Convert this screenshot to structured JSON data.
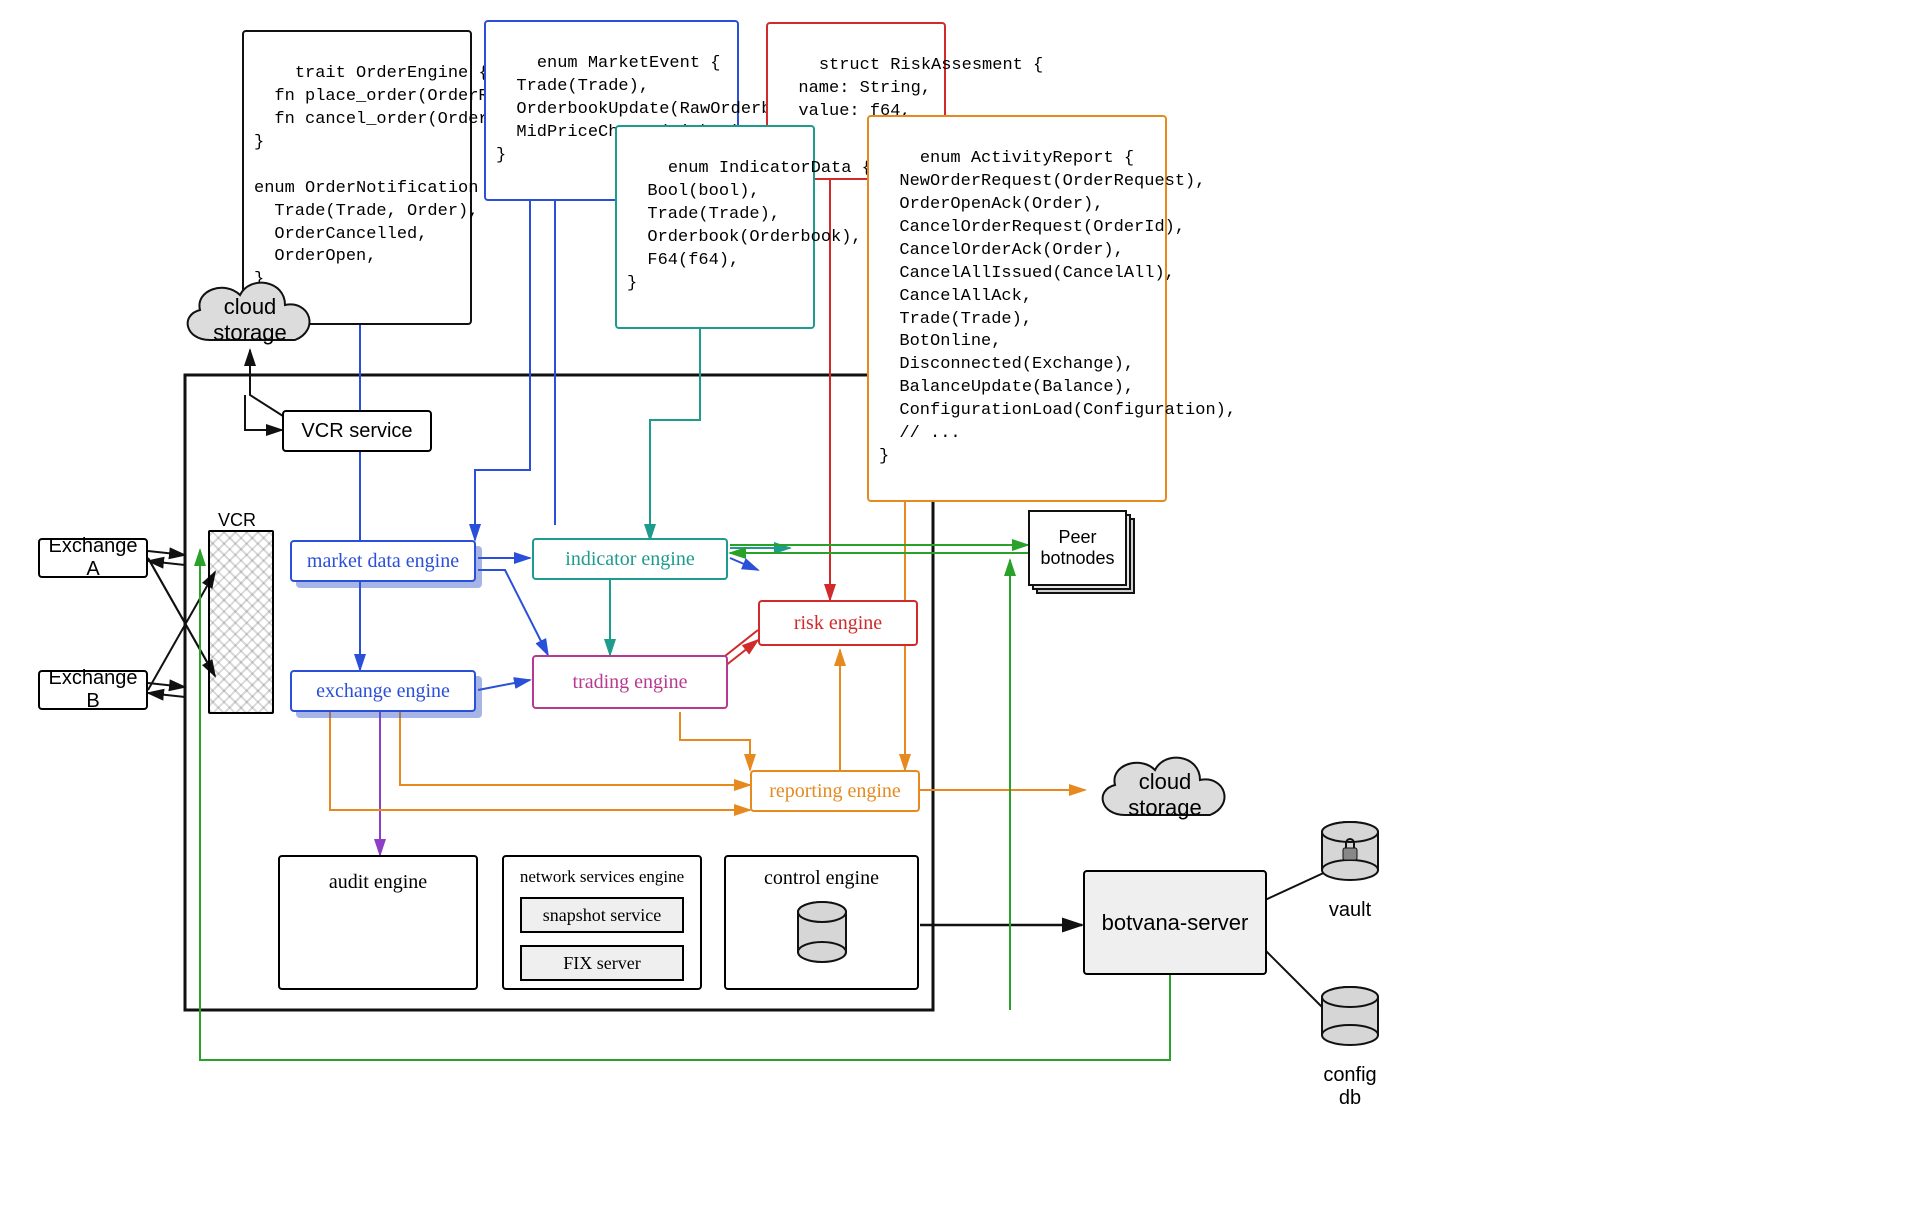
{
  "codeBlocks": {
    "orderEngine": "trait OrderEngine {\n  fn place_order(OrderRequest);\n  fn cancel_order(OrderId);\n}\n\nenum OrderNotification {\n  Trade(Trade, Order),\n  OrderCancelled,\n  OrderOpen,\n}",
    "marketEvent": "enum MarketEvent {\n  Trade(Trade),\n  OrderbookUpdate(RawOrderbook),\n  MidPriceChange(Ticker),\n}",
    "riskAssesment": "struct RiskAssesment {\n  name: String,\n  value: f64,\n}",
    "indicatorData": "enum IndicatorData {\n  Bool(bool),\n  Trade(Trade),\n  Orderbook(Orderbook),\n  F64(f64),\n}",
    "activityReport": "enum ActivityReport {\n  NewOrderRequest(OrderRequest),\n  OrderOpenAck(Order),\n  CancelOrderRequest(OrderId),\n  CancelOrderAck(Order),\n  CancelAllIssued(CancelAll),\n  CancelAllAck,\n  Trade(Trade),\n  BotOnline,\n  Disconnected(Exchange),\n  BalanceUpdate(Balance),\n  ConfigurationLoad(Configuration),\n  // ...\n}"
  },
  "externals": {
    "exchangeA": "Exchange A",
    "exchangeB": "Exchange B",
    "cloudStorage1": "cloud\nstorage",
    "cloudStorage2": "cloud\nstorage",
    "peerBotnodes": "Peer\nbotnodes",
    "botvanaServer": "botvana-server",
    "vault": "vault",
    "configDb": "config db"
  },
  "internals": {
    "vcrLabel": "VCR",
    "vcrService": "VCR service",
    "marketDataEngine": "market data engine",
    "exchangeEngine": "exchange engine",
    "indicatorEngine": "indicator engine",
    "tradingEngine": "trading engine",
    "riskEngine": "risk engine",
    "reportingEngine": "reporting engine",
    "auditEngine": "audit engine",
    "networkServicesEngine": "network services engine",
    "snapshotService": "snapshot service",
    "fixServer": "FIX server",
    "controlEngine": "control engine"
  },
  "colors": {
    "blue": "#2a4fd8",
    "teal": "#1d9b8c",
    "red": "#d02a2a",
    "orange": "#e68a1f",
    "purple": "#8b3fc7",
    "magenta": "#b83a8f",
    "green": "#2aa12a",
    "black": "#111111",
    "grey": "#bdbdbd"
  }
}
